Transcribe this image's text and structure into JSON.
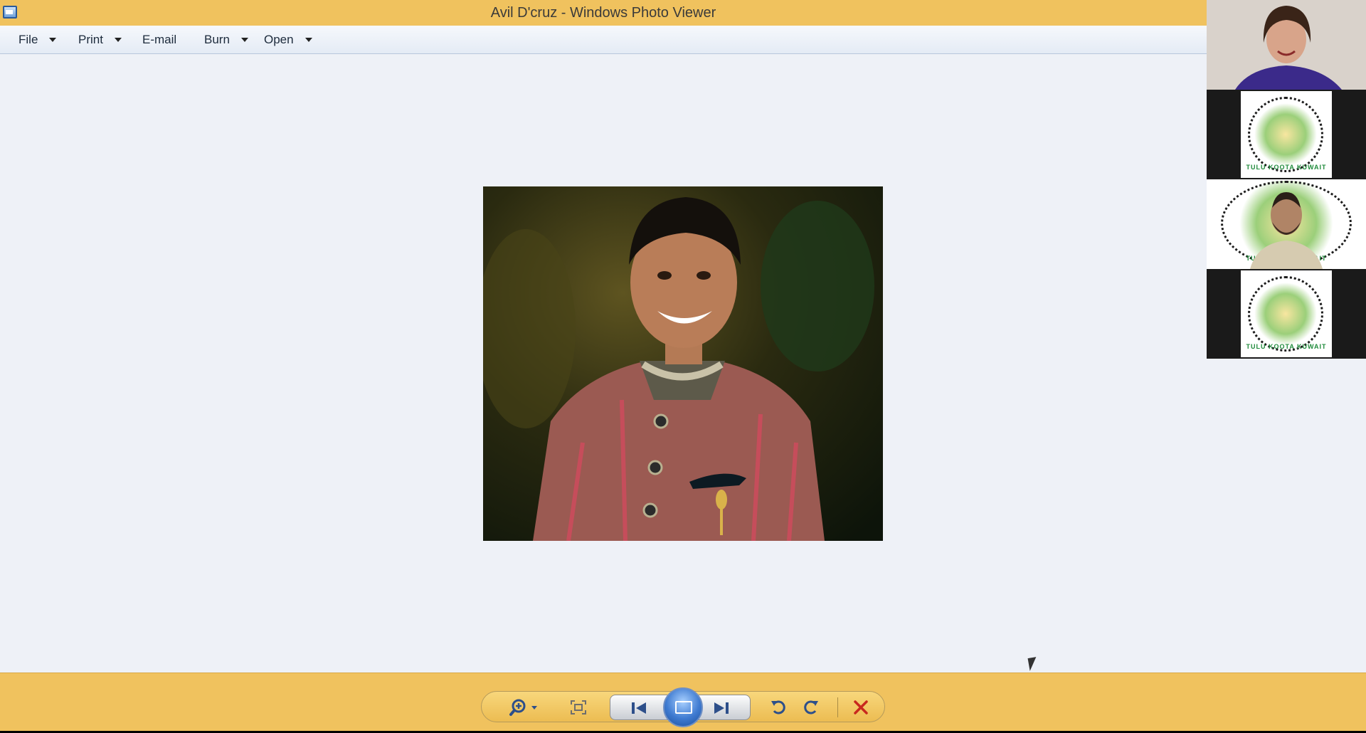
{
  "window": {
    "title": "Avil D'cruz - Windows Photo Viewer",
    "accent_color": "#f0c25e",
    "canvas_color": "#eef1f7"
  },
  "menu": {
    "items": [
      {
        "label": "File",
        "has_dropdown": true
      },
      {
        "label": "Print",
        "has_dropdown": true
      },
      {
        "label": "E-mail",
        "has_dropdown": false
      },
      {
        "label": "Burn",
        "has_dropdown": true
      },
      {
        "label": "Open",
        "has_dropdown": true
      }
    ]
  },
  "toolbar": {
    "buttons": [
      {
        "name": "zoom",
        "icon": "magnifier-plus-icon"
      },
      {
        "name": "actual-size",
        "icon": "fit-window-icon"
      },
      {
        "name": "previous",
        "icon": "skip-back-icon"
      },
      {
        "name": "slideshow",
        "icon": "slideshow-icon"
      },
      {
        "name": "next",
        "icon": "skip-forward-icon"
      },
      {
        "name": "rotate-ccw",
        "icon": "rotate-left-icon"
      },
      {
        "name": "rotate-cw",
        "icon": "rotate-right-icon"
      },
      {
        "name": "delete",
        "icon": "delete-x-icon"
      }
    ]
  },
  "video_call": {
    "participants": [
      {
        "type": "camera"
      },
      {
        "type": "logo",
        "logo_text": "TULU KOOTA KUWAIT"
      },
      {
        "type": "camera-with-logo-background",
        "logo_text": "TULU KOOTA KUWAIT"
      },
      {
        "type": "logo",
        "logo_text": "TULU KOOTA KUWAIT"
      }
    ]
  }
}
